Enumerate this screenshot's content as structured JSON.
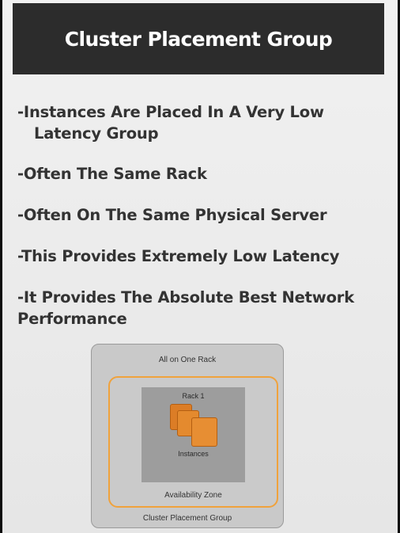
{
  "slide": {
    "title": "Cluster Placement Group",
    "bullets": [
      "-Instances Are Placed In A Very Low Latency Group",
      "-Often The Same Rack",
      "-Often On The Same Physical Server",
      "-This Provides Extremely Low Latency",
      "-It Provides The Absolute Best Network Performance"
    ]
  },
  "diagram": {
    "outer_top_label": "All on One Rack",
    "outer_bottom_label": "Cluster Placement Group",
    "zone_label": "Availability Zone",
    "rack_label": "Rack 1",
    "instances_label": "Instances",
    "icon_name": "ec2-instances-icon"
  },
  "colors": {
    "title_bar": "#2c2c2c",
    "zone_border": "#f0a23c",
    "instance": "#e1842a"
  }
}
